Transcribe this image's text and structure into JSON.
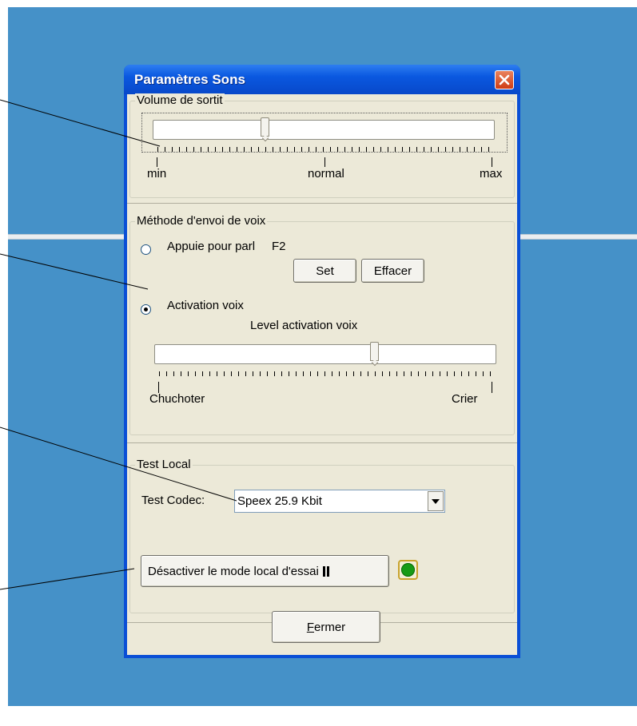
{
  "window": {
    "title": "Paramètres Sons"
  },
  "volume": {
    "legend": "Volume de sortit",
    "labels": {
      "min": "min",
      "normal": "normal",
      "max": "max"
    },
    "level": 0.32
  },
  "voice_method": {
    "legend": "Méthode d'envoi de voix",
    "push_to_talk": {
      "label": "Appuie pour parl",
      "hotkey": "F2",
      "selected": false
    },
    "set_button": "Set",
    "clear_button": "Effacer",
    "voice_activation": {
      "label": "Activation voix",
      "selected": true
    },
    "level_title": "Level activation voix",
    "level_min_label": "Chuchoter",
    "level_max_label": "Crier",
    "level": 0.65
  },
  "test_local": {
    "legend": "Test Local",
    "codec_label": "Test Codec:",
    "codec_value": "Speex 25.9 Kbit",
    "toggle_button": "Désactiver le mode local d'essai",
    "status_color": "#169b16"
  },
  "footer": {
    "close_button": "Fermer"
  },
  "colors": {
    "desktop": "#4591c8",
    "titlebar": "#0a58e0",
    "dialog_bg": "#ece9d8"
  }
}
